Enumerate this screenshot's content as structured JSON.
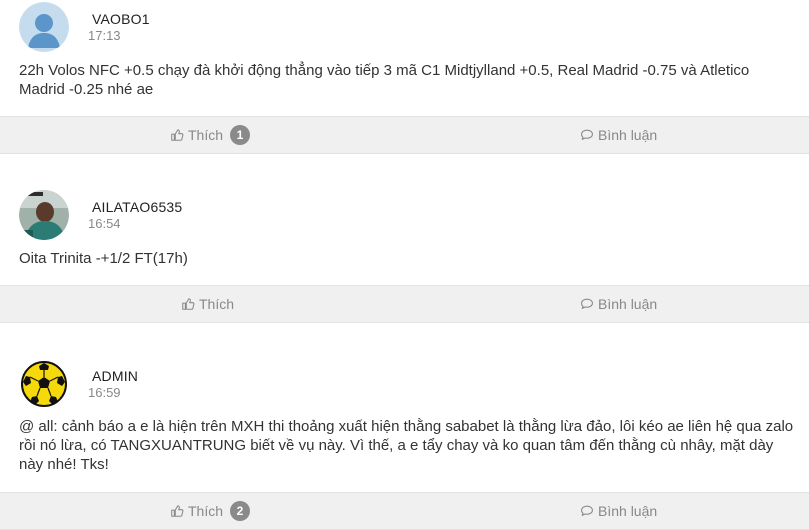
{
  "posts": [
    {
      "username": "VAOBO1",
      "time": "17:13",
      "text": "22h Volos NFC +0.5 chạy đà khởi động thẳng vào tiếp 3 mã C1 Midtjylland +0.5, Real Madrid -0.75 và Atletico Madrid -0.25 nhé ae",
      "like_label": "Thích",
      "like_count": "1",
      "comment_label": "Bình luận",
      "avatar": "default-user-avatar"
    },
    {
      "username": "AILATAO6535",
      "time": "16:54",
      "text": "Oita Trinita -+1/2 FT(17h)",
      "like_label": "Thích",
      "like_count": null,
      "comment_label": "Bình luận",
      "avatar": "photo-avatar"
    },
    {
      "username": "ADMIN",
      "time": "16:59",
      "text": "@ all: cảnh báo a e là hiện trên MXH thi thoảng xuất hiện thằng sababet là thằng lừa đảo, lôi kéo ae liên hệ qua zalo rồi nó lừa, có TANGXUANTRUNG biết về vụ này. Vì thế, a e tẩy chay và ko quan tâm đến thằng cù nhây, mặt dày này nhé! Tks!",
      "like_label": "Thích",
      "like_count": "2",
      "comment_label": "Bình luận",
      "avatar": "soccer-ball-avatar"
    }
  ],
  "colors": {
    "action_bar_bg": "#f0f0f0",
    "badge_bg": "#8a8a8a",
    "avatar_default_bg": "#c5dcef",
    "avatar_default_fg": "#5b95c9",
    "soccer_yellow": "#f5d90a"
  }
}
